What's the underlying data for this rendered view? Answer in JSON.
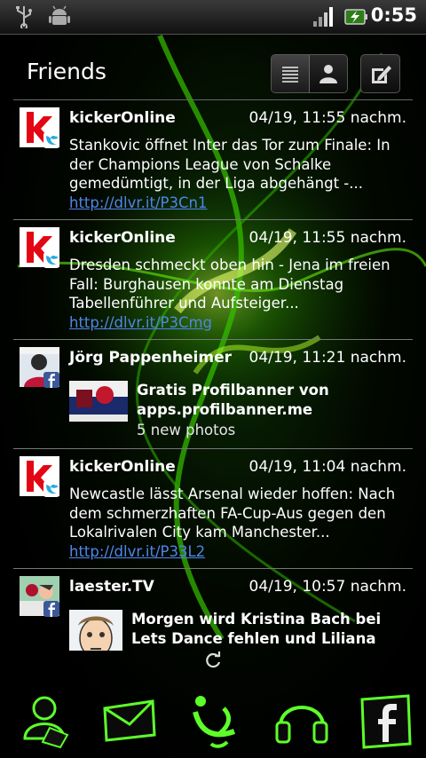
{
  "status_bar": {
    "time": "0:55",
    "icons": [
      "usb-icon",
      "android-debug-icon",
      "signal-icon",
      "battery-charging-icon"
    ]
  },
  "header": {
    "title": "Friends",
    "view_buttons": [
      "list-view-icon",
      "person-view-icon"
    ],
    "compose_icon": "compose-icon"
  },
  "feed": [
    {
      "source": "twitter",
      "name": "kickerOnline",
      "time": "04/19, 11:55 nachm.",
      "text": "Stankovic öffnet Inter das Tor zum Finale: In der Champions League von Schalke gemedümtigt, in der Liga abgehängt -... ",
      "link": "http://dlvr.it/P3Cn1"
    },
    {
      "source": "twitter",
      "name": "kickerOnline",
      "time": "04/19, 11:55 nachm.",
      "text": "Dresden schmeckt oben hin - Jena im freien Fall: Burghausen konnte am Dienstag Tabellenführer und Aufsteiger... ",
      "link": "http://dlvr.it/P3Cmg"
    },
    {
      "source": "facebook",
      "name": "Jörg Pappenheimer",
      "time": "04/19, 11:21 nachm.",
      "post_title": "Gratis Profilbanner von apps.profilbanner.me",
      "post_sub": "5 new photos"
    },
    {
      "source": "twitter",
      "name": "kickerOnline",
      "time": "04/19, 11:04 nachm.",
      "text": "Newcastle lässt Arsenal wieder hoffen: Nach dem schmerzhaften FA-Cup-Aus gegen den Lokalrivalen City kam Manchester... ",
      "link": "http://dlvr.it/P33L2"
    },
    {
      "source": "facebook",
      "name": "laester.TV",
      "time": "04/19, 10:57 nachm.",
      "post_title": "Morgen wird Kristina Bach bei Lets Dance fehlen und Liliana Matthäus"
    }
  ],
  "dock": {
    "items": [
      "contacts-icon",
      "messaging-icon",
      "timescape-icon",
      "music-icon",
      "facebook-icon"
    ]
  },
  "colors": {
    "link": "#4f86e8",
    "accent_green": "#5dff2a",
    "twitter_blue": "#2aa9e0",
    "facebook_blue": "#3b5998",
    "kicker_red": "#e30613"
  }
}
